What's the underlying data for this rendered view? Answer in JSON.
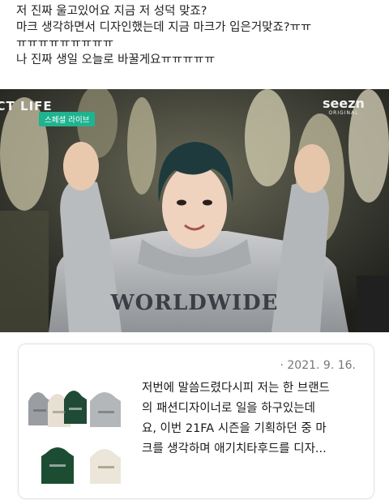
{
  "post": {
    "lines": [
      "저 진짜 울고있어요 지금 저 성덕 맞죠?",
      "마크 생각하면서 디자인했는데 지금 마크가 입은거맞죠?ㅠㅠ",
      "ㅠㅠㅠㅠㅠㅠㅠㅠㅠ",
      "나 진짜 생일 오늘로 바꿀게요ㅠㅠㅠㅠㅠ"
    ]
  },
  "video": {
    "show_logo": "NCT LIFE",
    "segment_badge": "스페셜 라이브",
    "channel_logo": "seezn",
    "channel_sub": "ORIGINAL",
    "hoodie_print": "WORLDWIDE"
  },
  "comment": {
    "date": "· 2021. 9. 16.",
    "body_lines": [
      "저번에 말씀드렸다시피 저는 한 브랜드",
      "의 패션디자이너로 일을 하구있는데",
      "요, 이번 21FA 시즌을 기획하던 중 마",
      "크를 생각하며 애기치타후드를 디자..."
    ],
    "product_colors": [
      "#9a9ea3",
      "#e8e0d2",
      "#1f4a35",
      "#b4b7ba",
      "#1c4d33",
      "#ece6da"
    ]
  }
}
